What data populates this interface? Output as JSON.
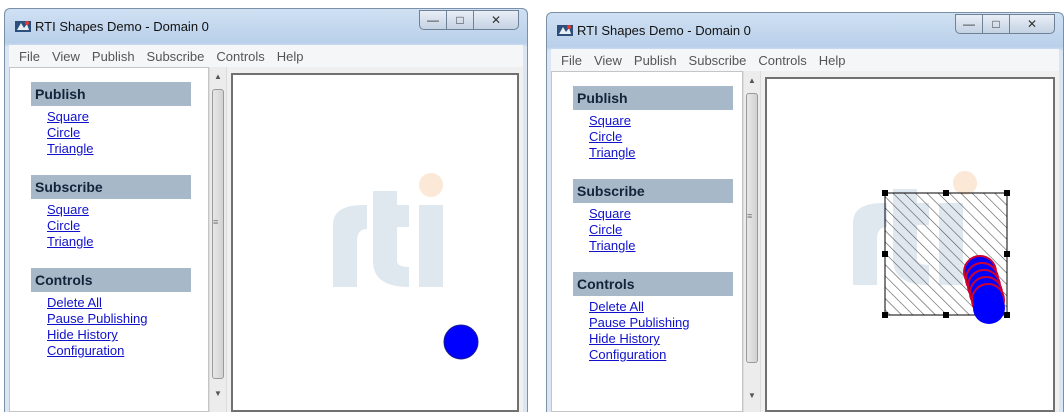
{
  "windows": [
    {
      "title": "RTI Shapes Demo - Domain 0",
      "menu": [
        "File",
        "View",
        "Publish",
        "Subscribe",
        "Controls",
        "Help"
      ],
      "sections": [
        {
          "header": "Publish",
          "links": [
            "Square",
            "Circle",
            "Triangle"
          ]
        },
        {
          "header": "Subscribe",
          "links": [
            "Square",
            "Circle",
            "Triangle"
          ]
        },
        {
          "header": "Controls",
          "links": [
            "Delete All",
            "Pause Publishing",
            "Hide History",
            "Configuration"
          ]
        }
      ],
      "canvas": {
        "logo_text": "rti",
        "shapes": [
          {
            "type": "circle",
            "color": "#0000ff"
          }
        ]
      }
    },
    {
      "title": "RTI Shapes Demo - Domain 0",
      "menu": [
        "File",
        "View",
        "Publish",
        "Subscribe",
        "Controls",
        "Help"
      ],
      "sections": [
        {
          "header": "Publish",
          "links": [
            "Square",
            "Circle",
            "Triangle"
          ]
        },
        {
          "header": "Subscribe",
          "links": [
            "Square",
            "Circle",
            "Triangle"
          ]
        },
        {
          "header": "Controls",
          "links": [
            "Delete All",
            "Pause Publishing",
            "Hide History",
            "Configuration"
          ]
        }
      ],
      "canvas": {
        "logo_text": "rti",
        "shapes": [
          {
            "type": "filter-rectangle",
            "pattern": "hatched",
            "selected": true
          },
          {
            "type": "circle-history",
            "color": "#0000ff",
            "outline": "#cc0033",
            "count": 5
          }
        ]
      }
    }
  ],
  "colors": {
    "section_header": "#a7b8c8",
    "link": "#1111cc",
    "shape_blue": "#0000ff",
    "logo": "#dfe7ef",
    "logo_dot": "#fbe8d6"
  },
  "icons": {
    "app": "rti-app-icon",
    "minimize": "minimize-icon",
    "maximize": "maximize-icon",
    "close": "close-icon",
    "scroll_up": "scroll-up-arrow-icon",
    "scroll_down": "scroll-down-arrow-icon"
  }
}
